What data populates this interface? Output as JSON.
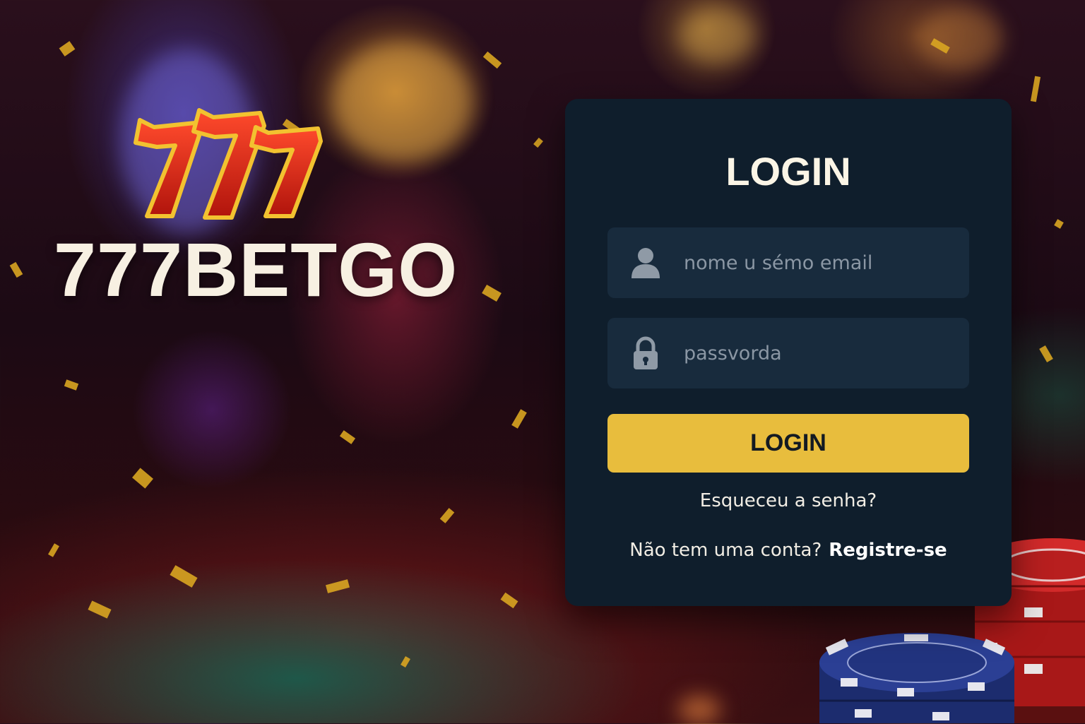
{
  "brand": {
    "logo_mark": "777",
    "name": "777BETGO"
  },
  "login_card": {
    "title": "LOGIN",
    "username_field": {
      "placeholder": "nome u sémo email",
      "value": "",
      "icon": "user-icon"
    },
    "password_field": {
      "placeholder": "passvorda",
      "value": "",
      "icon": "lock-icon"
    },
    "login_button_label": "LOGIN",
    "forgot_password_link": "Esqueceu a senha?",
    "signup_prompt": "Não tem uma conta?",
    "signup_link": "Registre-se"
  },
  "colors": {
    "card_background": "#0f1e2c",
    "field_background": "#182b3d",
    "accent_button": "#e8bd3d",
    "logo_red": "#d62516",
    "logo_gold": "#f2c230"
  }
}
